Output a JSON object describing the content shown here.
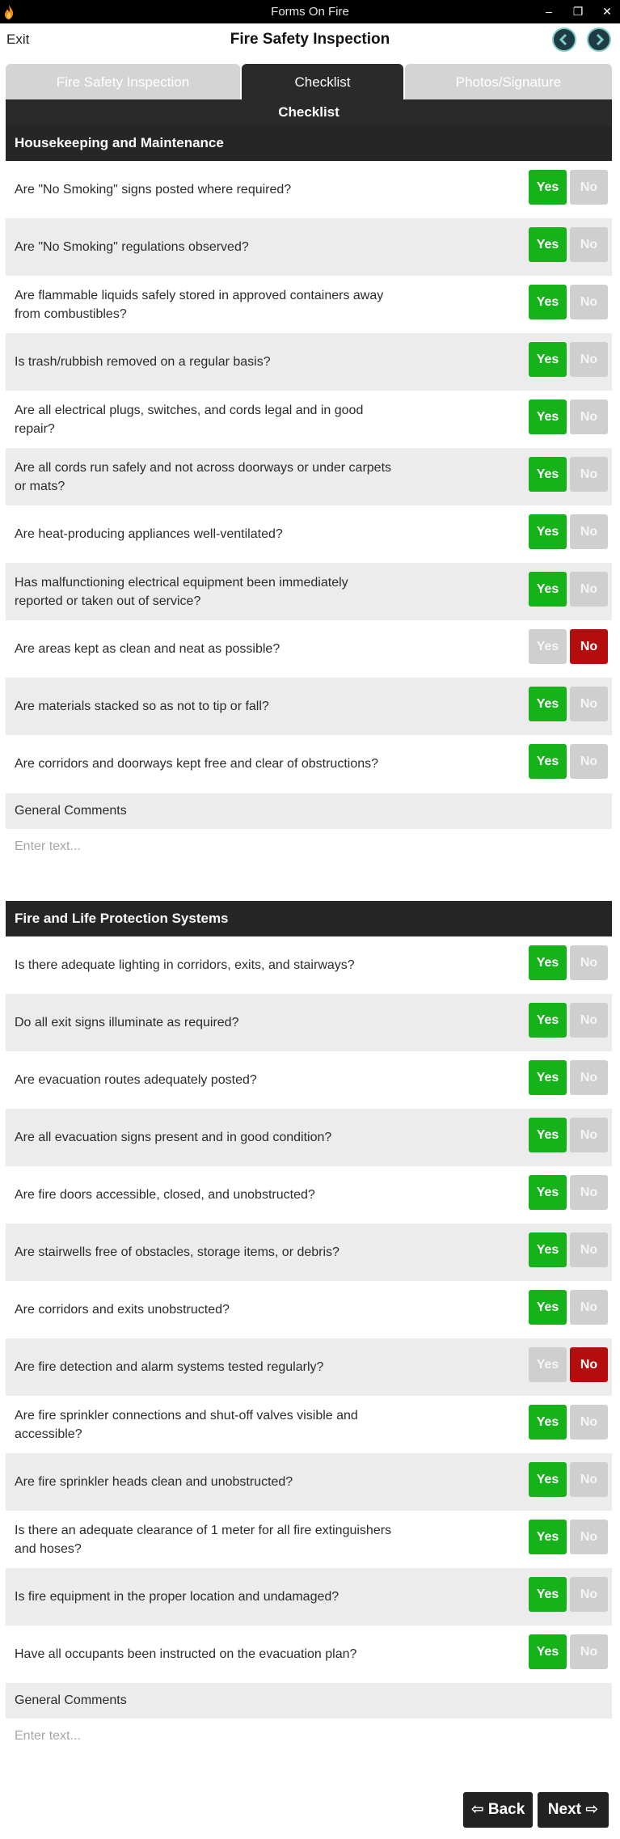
{
  "window": {
    "title": "Forms On Fire",
    "controls": {
      "minimize": "‒",
      "maximize": "❐",
      "close": "✕"
    }
  },
  "header": {
    "exit_label": "Exit",
    "title": "Fire Safety Inspection",
    "prev_icon": "chevron-left-icon",
    "next_icon": "chevron-right-icon"
  },
  "tabs": [
    {
      "label": "Fire Safety Inspection",
      "active": false
    },
    {
      "label": "Checklist",
      "active": true
    },
    {
      "label": "Photos/Signature",
      "active": false
    }
  ],
  "subheader": "Checklist",
  "colors": {
    "yes_active": "#16b21a",
    "no_active": "#b50d0d",
    "inactive": "#cfcfcf",
    "dark": "#262626"
  },
  "sections": [
    {
      "title": "Housekeeping and Maintenance",
      "questions": [
        {
          "text": "Are \"No Smoking\" signs posted where required?",
          "answer": "Yes"
        },
        {
          "text": "Are \"No Smoking\" regulations observed?",
          "answer": "Yes"
        },
        {
          "text": "Are flammable liquids safely stored in approved containers away from combustibles?",
          "answer": "Yes"
        },
        {
          "text": "Is trash/rubbish removed on a regular basis?",
          "answer": "Yes"
        },
        {
          "text": "Are all electrical plugs, switches, and cords legal and in good repair?",
          "answer": "Yes"
        },
        {
          "text": "Are all cords run safely and not across doorways or under carpets or mats?",
          "answer": "Yes"
        },
        {
          "text": "Are heat-producing appliances well-ventilated?",
          "answer": "Yes"
        },
        {
          "text": "Has malfunctioning electrical equipment been immediately reported or taken out of service?",
          "answer": "Yes"
        },
        {
          "text": "Are areas kept as clean and neat as possible?",
          "answer": "No"
        },
        {
          "text": "Are materials stacked so as not to tip or fall?",
          "answer": "Yes"
        },
        {
          "text": "Are corridors and doorways kept free and clear of obstructions?",
          "answer": "Yes"
        }
      ],
      "comments_label": "General Comments",
      "comments_placeholder": "Enter text..."
    },
    {
      "title": "Fire and Life Protection Systems",
      "questions": [
        {
          "text": "Is there adequate lighting in corridors, exits, and stairways?",
          "answer": "Yes"
        },
        {
          "text": "Do all exit signs illuminate as required?",
          "answer": "Yes"
        },
        {
          "text": "Are evacuation routes adequately posted?",
          "answer": "Yes"
        },
        {
          "text": "Are all evacuation signs present and in good condition?",
          "answer": "Yes"
        },
        {
          "text": "Are fire doors accessible, closed, and unobstructed?",
          "answer": "Yes"
        },
        {
          "text": "Are stairwells free of obstacles, storage items, or debris?",
          "answer": "Yes"
        },
        {
          "text": "Are corridors and exits unobstructed?",
          "answer": "Yes"
        },
        {
          "text": "Are fire detection and alarm systems tested regularly?",
          "answer": "No"
        },
        {
          "text": "Are fire sprinkler connections and shut-off valves visible and accessible?",
          "answer": "Yes"
        },
        {
          "text": "Are fire sprinkler heads clean and unobstructed?",
          "answer": "Yes"
        },
        {
          "text": "Is there an adequate clearance of 1 meter for all fire extinguishers and hoses?",
          "answer": "Yes"
        },
        {
          "text": "Is fire equipment in the proper location and undamaged?",
          "answer": "Yes"
        },
        {
          "text": "Have all occupants been instructed on the evacuation plan?",
          "answer": "Yes"
        }
      ],
      "comments_label": "General Comments",
      "comments_placeholder": "Enter text..."
    }
  ],
  "buttons": {
    "yes_label": "Yes",
    "no_label": "No"
  },
  "footer": {
    "back_label": "⇦ Back",
    "next_label": "Next ⇨"
  }
}
